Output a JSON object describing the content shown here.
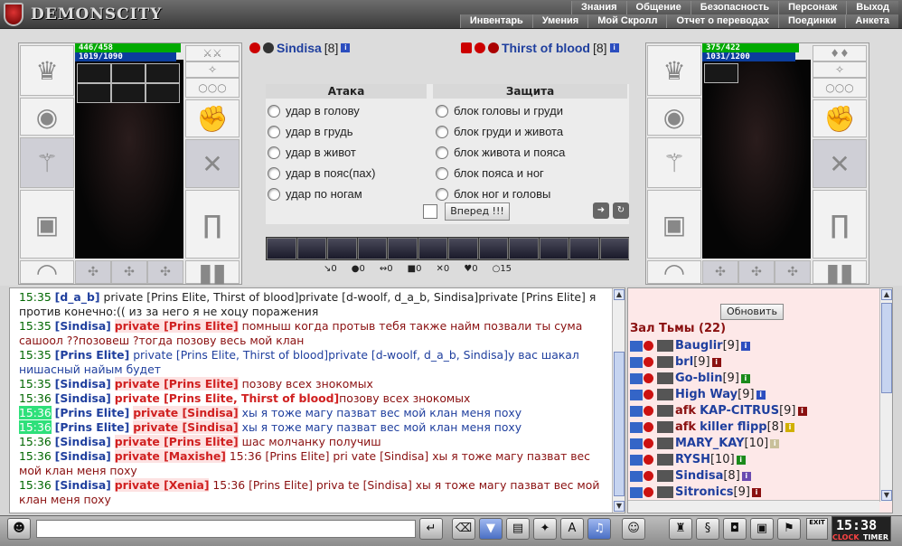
{
  "app": {
    "logo_text": "DEMONSCITY"
  },
  "menu_top": [
    "Знания",
    "Общение",
    "Безопасность",
    "Персонаж",
    "Выход"
  ],
  "menu_bottom": [
    "Инвентарь",
    "Умения",
    "Мой Скролл",
    "Отчет о переводах",
    "Поединки",
    "Анкета"
  ],
  "player_left": {
    "name": "Sindisa",
    "level": "[8]",
    "hp": "446/458",
    "mp": "1019/1090",
    "hp_fraction": 0.974,
    "mp_fraction": 0.935
  },
  "player_right": {
    "name": "Thirst of blood",
    "level": "[8]",
    "hp": "375/422",
    "mp": "1031/1200",
    "hp_fraction": 0.889,
    "mp_fraction": 0.859
  },
  "fight": {
    "attack_title": "Атака",
    "defense_title": "Защита",
    "attacks": [
      "удар в голову",
      "удар в грудь",
      "удар в живот",
      "удар в пояс(пах)",
      "удар по ногам"
    ],
    "defenses": [
      "блок головы и груди",
      "блок груди и живота",
      "блок живота и пояса",
      "блок пояса и ног",
      "блок ног и головы"
    ],
    "forward_label": "Вперед !!!"
  },
  "stats": [
    "0",
    "0",
    "0",
    "0",
    "0",
    "0",
    "15"
  ],
  "chat": [
    {
      "time": "15:35",
      "time_hl": false,
      "nick": "[d_a_b]",
      "priv": "",
      "priv_hl": false,
      "text": " private [Prins Elite, Thirst of blood]private [d-woolf, d_a_b, Sindisa]private [Prins Elite] я против конечно:(( из за него я не хоцу поражения",
      "style": "d"
    },
    {
      "time": "15:35",
      "time_hl": false,
      "nick": "[Sindisa]",
      "priv": "private [Prins Elite]",
      "priv_hl": true,
      "text": " помныш когда протыв тебя также найм позвали ты сума сашоол ??позовеш ?тогда позову весь мой клан",
      "style": "r"
    },
    {
      "time": "15:35",
      "time_hl": false,
      "nick": "[Prins Elite]",
      "priv": "",
      "priv_hl": false,
      "text": " private [Prins Elite, Thirst of blood]private [d-woolf, d_a_b, Sindisa]у вас шакал нишасный найым будет",
      "style": "b"
    },
    {
      "time": "15:35",
      "time_hl": false,
      "nick": "[Sindisa]",
      "priv": "private [Prins Elite]",
      "priv_hl": true,
      "text": " позову всех знокомых",
      "style": "r"
    },
    {
      "time": "15:36",
      "time_hl": false,
      "nick": "[Sindisa]",
      "priv": "private [Prins Elite, Thirst of blood]",
      "priv_hl": false,
      "text": "позову всех знокомых",
      "style": "r"
    },
    {
      "time": "15:36",
      "time_hl": true,
      "nick": "[Prins Elite]",
      "priv": "private [Sindisa]",
      "priv_hl": true,
      "text": " хы я тоже магу пазват вес мой клан меня поху",
      "style": "b"
    },
    {
      "time": "15:36",
      "time_hl": true,
      "nick": "[Prins Elite]",
      "priv": "private [Sindisa]",
      "priv_hl": true,
      "text": " хы я тоже магу пазват вес мой клан меня поху",
      "style": "b"
    },
    {
      "time": "15:36",
      "time_hl": false,
      "nick": "[Sindisa]",
      "priv": "private [Prins Elite]",
      "priv_hl": true,
      "text": " шас молчанку получиш",
      "style": "r"
    },
    {
      "time": "15:36",
      "time_hl": false,
      "nick": "[Sindisa]",
      "priv": "private [Maxishe]",
      "priv_hl": true,
      "text": " 15:36 [Prins Elite] pri vate [Sindisa] хы я тоже магу пазват вес мой клан меня поху",
      "style": "r"
    },
    {
      "time": "15:36",
      "time_hl": false,
      "nick": "[Sindisa]",
      "priv": "private [Xenia]",
      "priv_hl": true,
      "text": " 15:36 [Prins Elite] priva te [Sindisa] хы я тоже магу пазват вес мой клан меня поху",
      "style": "r"
    }
  ],
  "side": {
    "refresh_label": "Обновить",
    "hall_title": "Зал Тьмы (22)",
    "players": [
      {
        "afk": "",
        "name": "Bauglir",
        "level": "[9]",
        "info_color": "#2c4ebf"
      },
      {
        "afk": "",
        "name": "brl",
        "level": "[9]",
        "info_color": "#8a1010"
      },
      {
        "afk": "",
        "name": "Go-blin",
        "level": "[9]",
        "info_color": "#1a8a1a"
      },
      {
        "afk": "",
        "name": "High Way",
        "level": "[9]",
        "info_color": "#2c4ebf"
      },
      {
        "afk": "afk",
        "name": "KAP-CITRUS",
        "level": "[9]",
        "info_color": "#8a1010"
      },
      {
        "afk": "afk",
        "name": "killer flipp",
        "level": "[8]",
        "info_color": "#d0b000"
      },
      {
        "afk": "",
        "name": "MARY_KAY",
        "level": "[10]",
        "info_color": "#c9c09a"
      },
      {
        "afk": "",
        "name": "RYSH",
        "level": "[10]",
        "info_color": "#1a8a1a"
      },
      {
        "afk": "",
        "name": "Sindisa",
        "level": "[8]",
        "info_color": "#6a4ab0"
      },
      {
        "afk": "",
        "name": "Sitronics",
        "level": "[9]",
        "info_color": "#8a1010"
      }
    ]
  },
  "clock": {
    "time": "15:38",
    "clock_label": "CLOCK",
    "timer_label": "TIMER",
    "exit_label": "EXIT"
  },
  "chat_input": {
    "placeholder": ""
  },
  "colors": {
    "nick_blue": "#1f3f9e",
    "private_red": "#d02020",
    "time_green": "#006600",
    "highlight_green": "#2ee07a"
  }
}
